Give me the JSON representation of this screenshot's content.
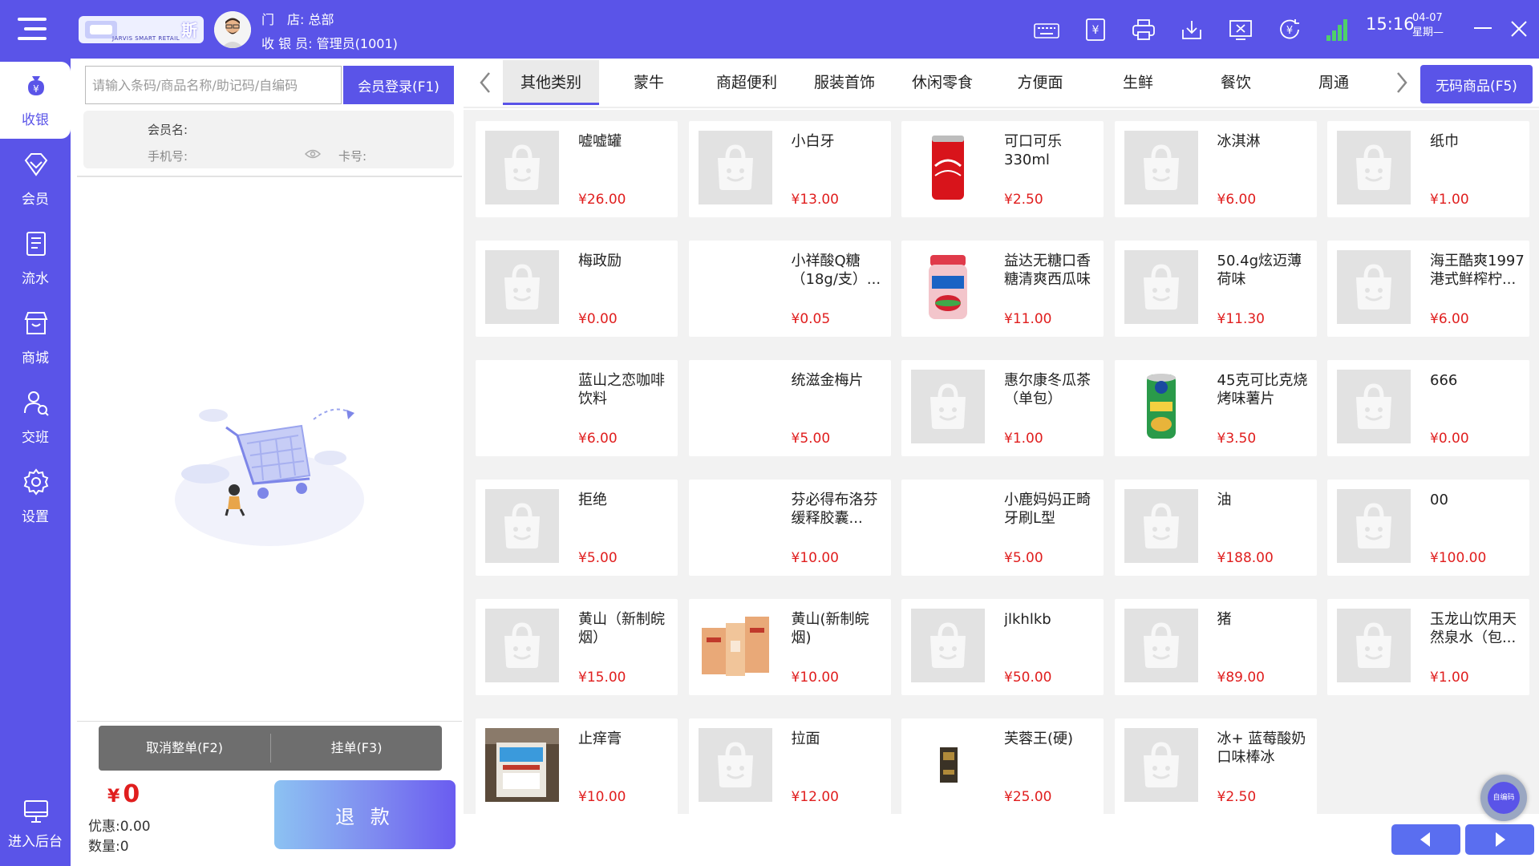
{
  "header": {
    "logo_text": "斯",
    "logo_sub": "JARVIS SMART RETAIL",
    "store_label": "门　店:",
    "store_value": "总部",
    "cashier_label": "收 银 员:",
    "cashier_value": "管理员(1001)",
    "time": "15:16",
    "date": "04-07",
    "weekday": "星期—",
    "icons": [
      "keyboard-icon",
      "yen-document-icon",
      "printer-icon",
      "download-icon",
      "screen-close-icon",
      "yen-refresh-icon",
      "signal-icon"
    ]
  },
  "sidenav": [
    {
      "label": "收银",
      "icon": "cashier-bag-icon",
      "active": true
    },
    {
      "label": "会员",
      "icon": "diamond-icon"
    },
    {
      "label": "流水",
      "icon": "document-icon"
    },
    {
      "label": "商城",
      "icon": "shop-icon"
    },
    {
      "label": "交班",
      "icon": "handover-user-icon"
    },
    {
      "label": "设置",
      "icon": "gear-icon"
    },
    {
      "label": "进入后台",
      "icon": "monitor-icon"
    }
  ],
  "left": {
    "search_placeholder": "请输入条码/商品名称/助记码/自编码",
    "member_login": "会员登录(F1)",
    "member_name_label": "会员名:",
    "phone_label": "手机号:",
    "card_label": "卡号:",
    "cancel_order": "取消整单(F2)",
    "hold_order": "挂单(F3)",
    "currency": "¥",
    "total": "0",
    "discount": "优惠:0.00",
    "count": "数量:0",
    "refund": "退 款"
  },
  "categories": {
    "tabs": [
      "其他类别",
      "蒙牛",
      "商超便利",
      "服装首饰",
      "休闲零食",
      "方便面",
      "生鲜",
      "餐饮",
      "周通"
    ],
    "active_index": 0,
    "nobarcode_btn": "无码商品(F5)"
  },
  "products": [
    {
      "name": "嘘嘘罐",
      "price": "¥26.00",
      "img": "placeholder"
    },
    {
      "name": "小白牙",
      "price": "¥13.00",
      "img": "placeholder"
    },
    {
      "name": "可口可乐330ml",
      "price": "¥2.50",
      "img": "coke"
    },
    {
      "name": "冰淇淋",
      "price": "¥6.00",
      "img": "placeholder"
    },
    {
      "name": "纸巾",
      "price": "¥1.00",
      "img": "placeholder"
    },
    {
      "name": "梅政励",
      "price": "¥0.00",
      "img": "placeholder"
    },
    {
      "name": "小祥酸Q糖（18g/支）...",
      "price": "¥0.05",
      "img": "none"
    },
    {
      "name": "益达无糖口香糖清爽西瓜味",
      "price": "¥11.00",
      "img": "gum"
    },
    {
      "name": "50.4g炫迈薄荷味",
      "price": "¥11.30",
      "img": "placeholder"
    },
    {
      "name": "海王酷爽1997港式鲜榨柠...",
      "price": "¥6.00",
      "img": "placeholder"
    },
    {
      "name": "蓝山之恋咖啡饮料",
      "price": "¥6.00",
      "img": "none"
    },
    {
      "name": "统滋金梅片",
      "price": "¥5.00",
      "img": "none"
    },
    {
      "name": "惠尔康冬瓜茶（单包）",
      "price": "¥1.00",
      "img": "placeholder"
    },
    {
      "name": "45克可比克烧烤味薯片",
      "price": "¥3.50",
      "img": "chips"
    },
    {
      "name": "666",
      "price": "¥0.00",
      "img": "placeholder"
    },
    {
      "name": "拒绝",
      "price": "¥5.00",
      "img": "placeholder"
    },
    {
      "name": "芬必得布洛芬缓释胶囊...",
      "price": "¥10.00",
      "img": "none"
    },
    {
      "name": "小鹿妈妈正畸牙刷L型",
      "price": "¥5.00",
      "img": "none"
    },
    {
      "name": "油",
      "price": "¥188.00",
      "img": "placeholder"
    },
    {
      "name": "00",
      "price": "¥100.00",
      "img": "placeholder"
    },
    {
      "name": "黄山（新制皖烟）",
      "price": "¥15.00",
      "img": "placeholder"
    },
    {
      "name": "黄山(新制皖烟)",
      "price": "¥10.00",
      "img": "cigarette"
    },
    {
      "name": "jlkhlkb",
      "price": "¥50.00",
      "img": "placeholder"
    },
    {
      "name": "猪",
      "price": "¥89.00",
      "img": "placeholder"
    },
    {
      "name": "玉龙山饮用天然泉水（包...",
      "price": "¥1.00",
      "img": "placeholder"
    },
    {
      "name": "止痒膏",
      "price": "¥10.00",
      "img": "ointment"
    },
    {
      "name": "拉面",
      "price": "¥12.00",
      "img": "placeholder"
    },
    {
      "name": "芙蓉王(硬)",
      "price": "¥25.00",
      "img": "furongwang"
    },
    {
      "name": "冰+ 蓝莓酸奶口味棒冰",
      "price": "¥2.50",
      "img": "placeholder"
    }
  ],
  "float_btn": "自编码",
  "colors": {
    "primary": "#5a54e8",
    "price": "#e01e1e"
  }
}
